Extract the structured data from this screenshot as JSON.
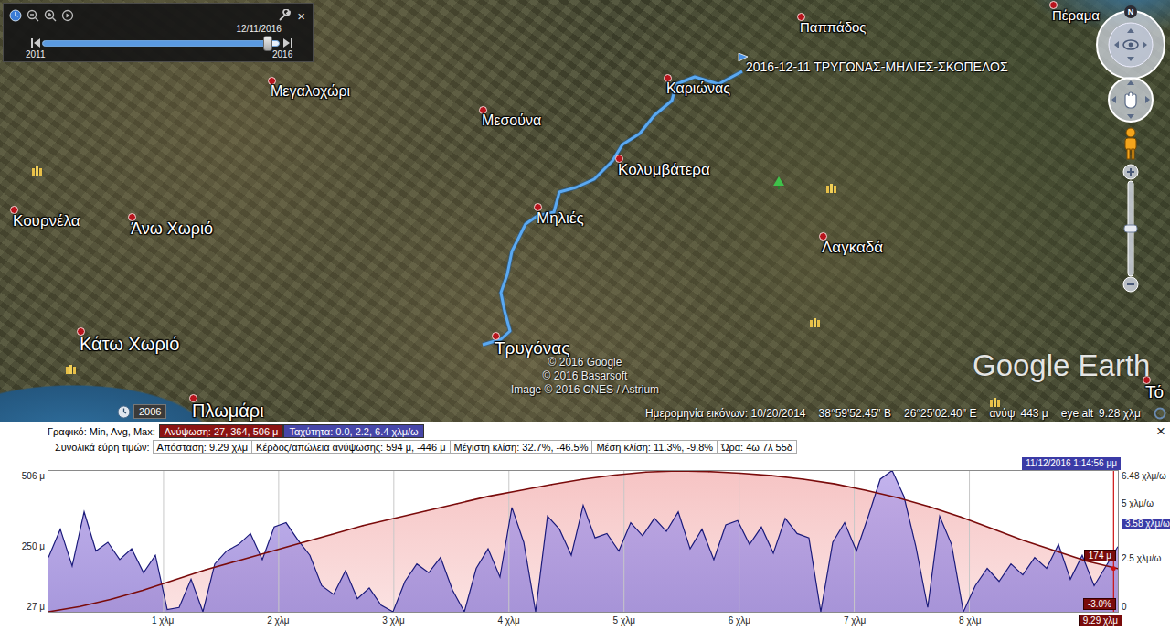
{
  "time_slider": {
    "date": "12/11/2016",
    "start": "2011",
    "end": "2016",
    "level": 0.95,
    "close": "×"
  },
  "compass": {
    "north": "N"
  },
  "places": [
    {
      "name": "Παππάδος"
    },
    {
      "name": "Πέραμα"
    },
    {
      "name": "Μεγαλοχώρι"
    },
    {
      "name": "Μεσούνα"
    },
    {
      "name": "Καριώνας"
    },
    {
      "name": "Κολυμβάτερα"
    },
    {
      "name": "Μηλιές"
    },
    {
      "name": "Λαγκαδά"
    },
    {
      "name": "Κουρνέλα"
    },
    {
      "name": "Άνω Χωριό"
    },
    {
      "name": "Κάτω Χωριό"
    },
    {
      "name": "Τρυγόνας"
    },
    {
      "name": "Πλωμάρι"
    },
    {
      "name": "Τό"
    }
  ],
  "track": {
    "label": "2016-12-11 ΤΡΥΓΩΝΑΣ-ΜΗΛΙΕΣ-ΣΚΟΠΕΛΟΣ"
  },
  "logo": "Google Earth",
  "attribution": [
    "© 2016 Google",
    "© 2016 Basarsoft",
    "Image © 2016 CNES / Astrium"
  ],
  "history_badge": "2006",
  "status_bar": {
    "imagery_date": "Ημερομηνία εικόνων: 10/20/2014",
    "lat": "38°59'52.45\" Β",
    "lon": "26°25'02.40\" Ε",
    "elev_label": "ανύψ",
    "elev": "443 μ",
    "eye_alt_label": "eye alt",
    "eye_alt": "9.28 χλμ"
  },
  "profile": {
    "close": "×",
    "graph_label": "Γραφικό: Min, Avg, Max:",
    "series_tabs": [
      {
        "label": "Ανύψωση: 27, 364, 506 μ",
        "selected": true,
        "color": "#8b1414"
      },
      {
        "label": "Ταχύτητα: 0.0, 2.2, 6.4 χλμ/ω",
        "selected": true,
        "color": "#4646a8"
      }
    ],
    "totals_label": "Συνολικά εύρη τιμών:",
    "totals": [
      "Απόσταση: 9.29 χλμ",
      "Κέρδος/απώλεια ανύψωσης: 594 μ, -446 μ",
      "Μέγιστη κλίση: 32.7%, -46.5%",
      "Μέση κλίση: 11.3%, -9.8%",
      "Ώρα: 4ω 7λ 55δ"
    ],
    "elevation_axis": [
      "506 μ",
      "250 μ",
      "27 μ"
    ],
    "speed_axis": [
      "6.48 χλμ/ω",
      "5 χλμ/ω",
      "2.5 χλμ/ω",
      "0"
    ],
    "distance_axis": [
      "1 χλμ",
      "2 χλμ",
      "3 χλμ",
      "4 χλμ",
      "5 χλμ",
      "6 χλμ",
      "7 χλμ",
      "8 χλμ"
    ],
    "distance_max": 9.29,
    "cursor": {
      "time": "11/12/2016 1:14:56 μμ",
      "elevation": "174 μ",
      "speed": "3.58 χλμ/ω",
      "slope": "-3.0%",
      "distance": "9.29 χλμ",
      "level": 0.996
    },
    "series": [
      {
        "name": "elevation",
        "min": 27,
        "max": 506,
        "color": "#7a0b0b",
        "values": [
          27,
          45,
          70,
          100,
          135,
          170,
          200,
          230,
          260,
          290,
          320,
          345,
          370,
          395,
          420,
          440,
          460,
          478,
          492,
          502,
          506,
          504,
          498,
          490,
          478,
          462,
          440,
          415,
          385,
          350,
          310,
          270,
          235,
          200,
          174
        ]
      },
      {
        "name": "speed",
        "min": 0,
        "max": 6.48,
        "color": "#1a1a7a",
        "values": [
          2.5,
          3.8,
          2.1,
          4.6,
          2.8,
          3.2,
          2.4,
          2.9,
          1.8,
          2.6,
          0.1,
          0.2,
          1.5,
          0.0,
          2.2,
          2.8,
          3.1,
          3.6,
          2.4,
          3.9,
          4.1,
          3.3,
          2.6,
          1.2,
          0.8,
          1.9,
          0.6,
          1.1,
          0.3,
          0.0,
          1.4,
          2.2,
          1.8,
          2.5,
          1.0,
          0.0,
          2.0,
          2.9,
          1.6,
          4.8,
          3.2,
          0.0,
          4.4,
          3.8,
          2.6,
          4.9,
          3.4,
          3.6,
          2.8,
          4.1,
          3.5,
          4.3,
          3.7,
          4.6,
          2.9,
          3.8,
          2.4,
          4.0,
          4.2,
          3.1,
          3.9,
          2.7,
          4.3,
          3.6,
          3.4,
          0.0,
          3.2,
          4.1,
          2.8,
          4.4,
          6.1,
          6.5,
          5.3,
          3.0,
          0.2,
          4.4,
          3.1,
          0.0,
          1.2,
          2.0,
          1.4,
          2.2,
          1.7,
          2.5,
          2.0,
          3.1,
          1.5,
          2.6,
          1.2,
          2.1,
          3.0
        ]
      }
    ]
  }
}
